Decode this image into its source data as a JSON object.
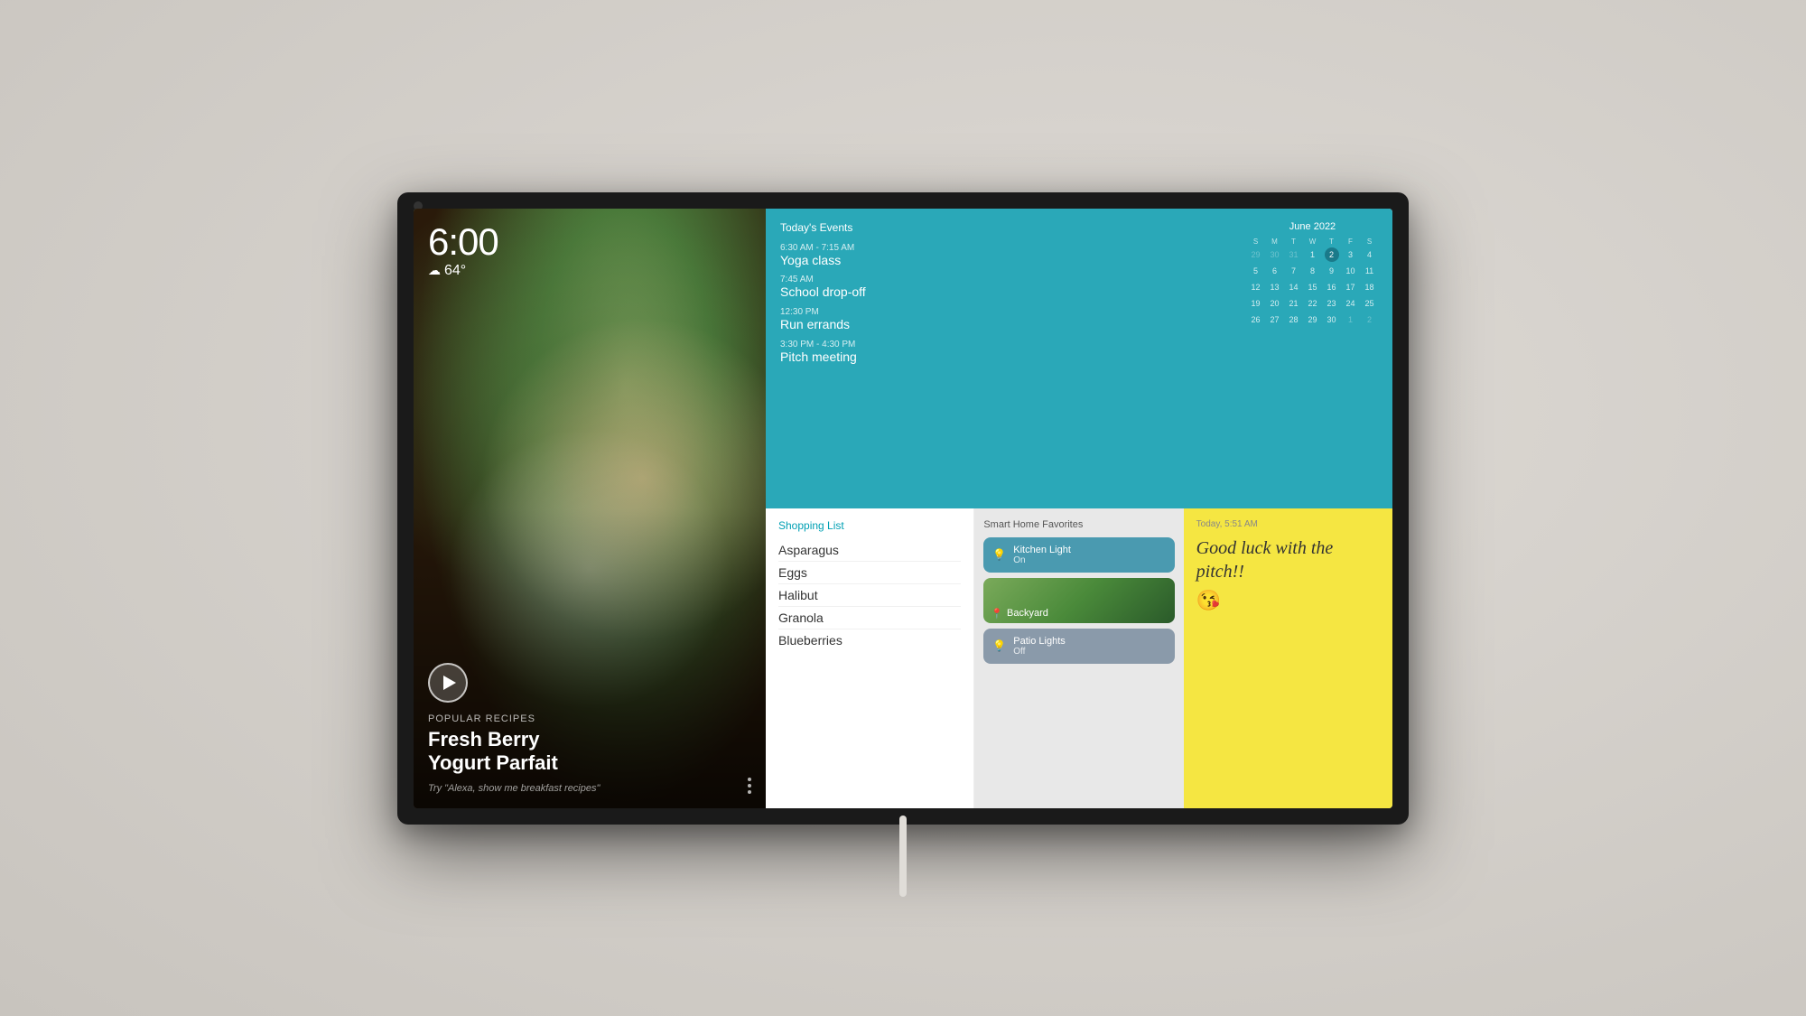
{
  "device": {
    "frame_color": "#1a1a1a"
  },
  "screen": {
    "time": "6:00",
    "weather": {
      "icon": "☁",
      "temp": "64°"
    },
    "media": {
      "popular_label": "Popular Recipes",
      "title_line1": "Fresh Berry",
      "title_line2": "Yogurt Parfait",
      "alexa_hint": "Try \"Alexa, show me breakfast recipes\""
    },
    "calendar": {
      "title": "Today's Events",
      "month_label": "June 2022",
      "day_headers": [
        "SUN",
        "MON",
        "TUE",
        "WED",
        "THU",
        "FRI",
        "SAT"
      ],
      "weeks": [
        [
          "29",
          "30",
          "31",
          "1",
          "2",
          "3",
          "4"
        ],
        [
          "5",
          "6",
          "7",
          "8",
          "9",
          "10",
          "11"
        ],
        [
          "12",
          "13",
          "14",
          "15",
          "16",
          "17",
          "18"
        ],
        [
          "19",
          "20",
          "21",
          "22",
          "23",
          "24",
          "25"
        ],
        [
          "26",
          "27",
          "28",
          "29",
          "30",
          "1",
          "2"
        ]
      ],
      "today": "2",
      "events": [
        {
          "time": "6:30 AM - 7:15 AM",
          "name": "Yoga class"
        },
        {
          "time": "7:45 AM",
          "name": "School drop-off"
        },
        {
          "time": "12:30 PM",
          "name": "Run errands"
        },
        {
          "time": "3:30 PM - 4:30 PM",
          "name": "Pitch meeting"
        }
      ]
    },
    "shopping": {
      "title": "Shopping List",
      "items": [
        "Asparagus",
        "Eggs",
        "Halibut",
        "Granola",
        "Blueberries"
      ]
    },
    "smarthome": {
      "title": "Smart Home Favorites",
      "devices": [
        {
          "name": "Kitchen Light",
          "status": "On",
          "state": "on",
          "icon": "💡"
        },
        {
          "name": "Backyard",
          "type": "scene"
        },
        {
          "name": "Patio Lights",
          "status": "Off",
          "state": "off",
          "icon": "💡"
        }
      ]
    },
    "note": {
      "time": "Today, 5:51 AM",
      "text": "Good luck with the pitch!!",
      "emoji": "😘"
    }
  }
}
